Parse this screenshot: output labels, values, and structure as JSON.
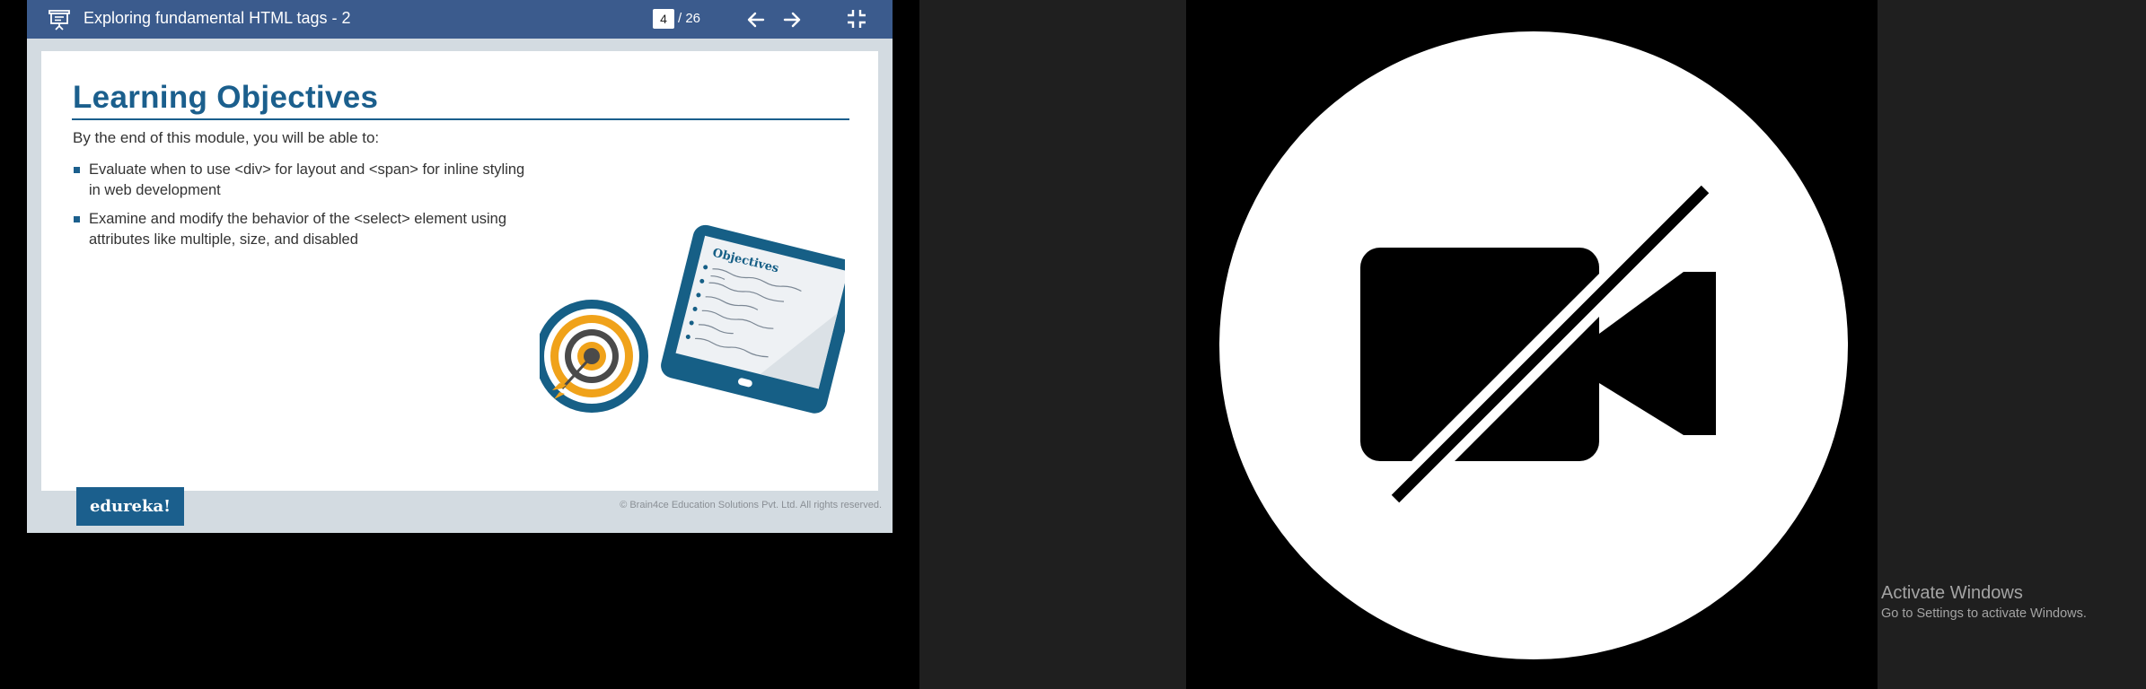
{
  "viewer": {
    "title": "Exploring fundamental HTML tags - 2",
    "current_page": "4",
    "total_pages": "/ 26",
    "icons": {
      "presentation": "presentation-icon",
      "prev": "arrow-left-icon",
      "next": "arrow-right-icon",
      "exit_fullscreen": "exit-fullscreen-icon"
    }
  },
  "slide": {
    "title": "Learning Objectives",
    "intro": "By the end of this module, you will be able to:",
    "objectives": [
      "Evaluate when to use <div> for layout and <span> for inline styling in web development",
      "Examine and modify the behavior of the <select> element using attributes like multiple, size, and disabled"
    ],
    "illustration_heading": "Objectives",
    "logo": "edureka!",
    "copyright": "© Brain4ce Education Solutions Pvt. Ltd. All rights reserved.",
    "colors": {
      "accent": "#1b5f8d",
      "toolbar": "#3b5b8d",
      "target_orange": "#f0a21a"
    }
  },
  "video": {
    "icon": "camera-off-icon"
  },
  "watermark": {
    "title": "Activate Windows",
    "subtitle": "Go to Settings to activate Windows."
  }
}
